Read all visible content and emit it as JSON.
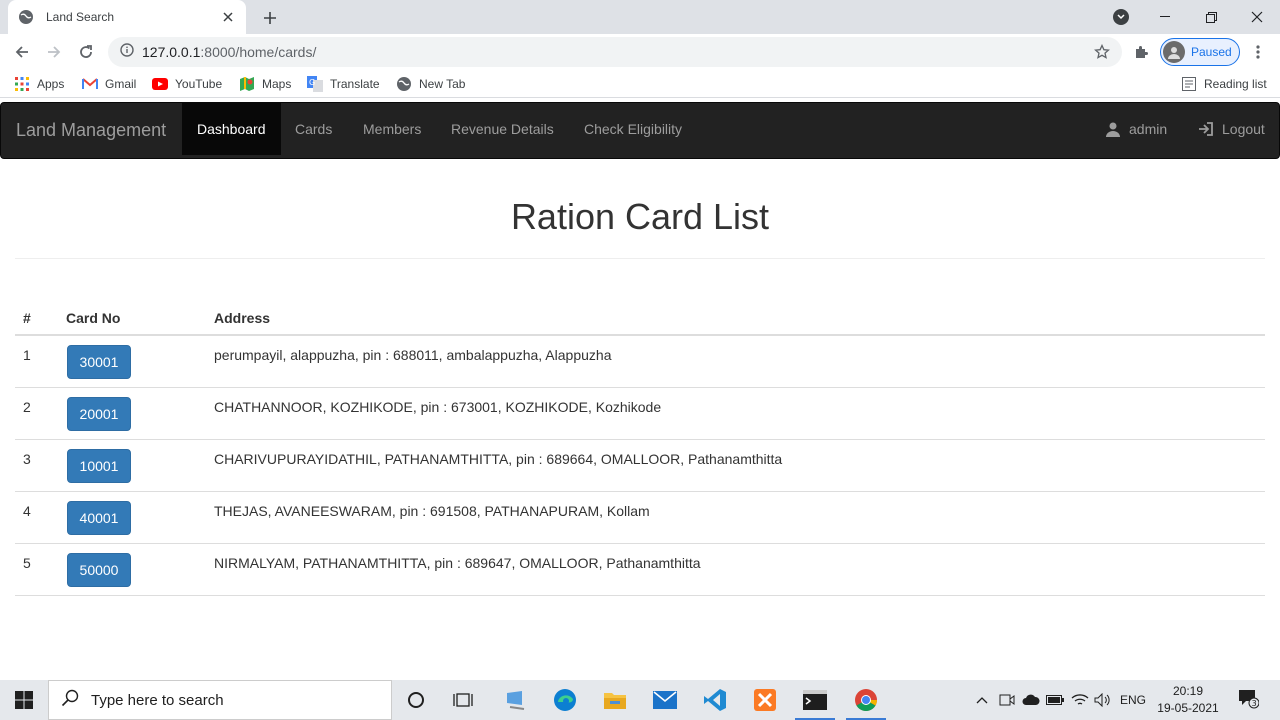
{
  "browser": {
    "tab_title": "Land Search",
    "url_host": "127.0.0.1",
    "url_path": ":8000/home/cards/",
    "profile_label": "Paused",
    "reading_list": "Reading list",
    "bookmarks": [
      {
        "label": "Apps",
        "icon": "apps-grid-icon"
      },
      {
        "label": "Gmail",
        "icon": "gmail-icon"
      },
      {
        "label": "YouTube",
        "icon": "youtube-icon"
      },
      {
        "label": "Maps",
        "icon": "maps-icon"
      },
      {
        "label": "Translate",
        "icon": "translate-icon"
      },
      {
        "label": "New Tab",
        "icon": "globe-icon"
      }
    ]
  },
  "navbar": {
    "brand": "Land Management",
    "items": [
      {
        "label": "Dashboard",
        "active": true
      },
      {
        "label": "Cards",
        "active": false
      },
      {
        "label": "Members",
        "active": false
      },
      {
        "label": "Revenue Details",
        "active": false
      },
      {
        "label": "Check Eligibility",
        "active": false
      }
    ],
    "user": "admin",
    "logout": "Logout"
  },
  "page": {
    "title": "Ration Card List",
    "columns": [
      "#",
      "Card No",
      "Address"
    ],
    "rows": [
      {
        "num": "1",
        "card": "30001",
        "address": "perumpayil, alappuzha, pin : 688011, ambalappuzha, Alappuzha"
      },
      {
        "num": "2",
        "card": "20001",
        "address": "CHATHANNOOR, KOZHIKODE, pin : 673001, KOZHIKODE, Kozhikode"
      },
      {
        "num": "3",
        "card": "10001",
        "address": "CHARIVUPURAYIDATHIL, PATHANAMTHITTA, pin : 689664, OMALLOOR, Pathanamthitta"
      },
      {
        "num": "4",
        "card": "40001",
        "address": "THEJAS, AVANEESWARAM, pin : 691508, PATHANAPURAM, Kollam"
      },
      {
        "num": "5",
        "card": "50000",
        "address": "NIRMALYAM, PATHANAMTHITTA, pin : 689647, OMALLOOR, Pathanamthitta"
      }
    ]
  },
  "taskbar": {
    "search_placeholder": "Type here to search",
    "language": "ENG",
    "time": "20:19",
    "date": "19-05-2021",
    "notification_count": "3"
  },
  "colors": {
    "navbar_bg": "#222222",
    "primary_button": "#337ab7"
  }
}
